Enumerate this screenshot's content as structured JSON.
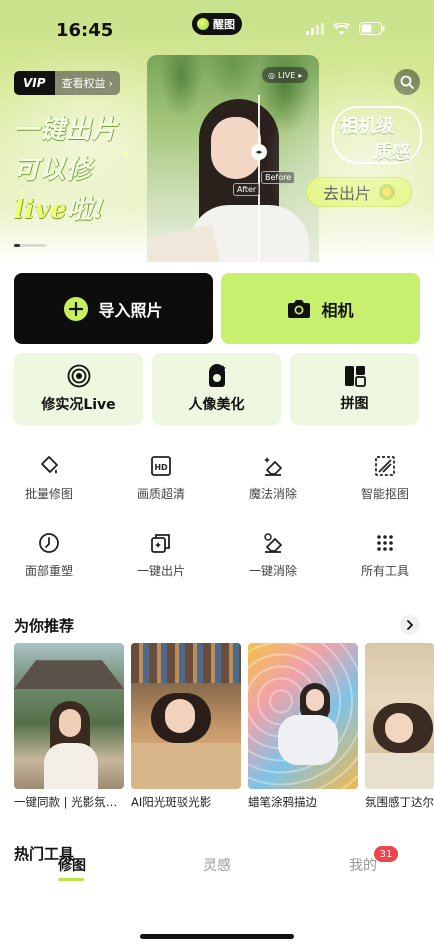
{
  "status_bar": {
    "time": "16:45",
    "island_label": "醒图"
  },
  "banner": {
    "vip_badge": "VIP",
    "vip_link": "查看权益",
    "slogan_line1": "一键出片",
    "slogan_line2_a": "可以修",
    "slogan_line2_b": "live",
    "slogan_line2_c": "啦!",
    "live_badge": "LIVE",
    "tag_after": "After",
    "tag_before": "Before",
    "camera_text_1": "相机级",
    "camera_text_2": "质感",
    "go_button": "去出片"
  },
  "actions": {
    "import": "导入照片",
    "camera": "相机"
  },
  "features": [
    {
      "label": "修实况Live",
      "icon": "live-photo-icon"
    },
    {
      "label": "人像美化",
      "icon": "portrait-icon"
    },
    {
      "label": "拼图",
      "icon": "collage-icon"
    }
  ],
  "tools": [
    {
      "label": "批量修图",
      "icon": "batch-edit-icon"
    },
    {
      "label": "画质超清",
      "icon": "hd-icon"
    },
    {
      "label": "魔法消除",
      "icon": "magic-eraser-icon"
    },
    {
      "label": "智能抠图",
      "icon": "cutout-icon"
    },
    {
      "label": "面部重塑",
      "icon": "face-reshape-icon"
    },
    {
      "label": "一键出片",
      "icon": "one-click-icon"
    },
    {
      "label": "一键消除",
      "icon": "one-click-erase-icon"
    },
    {
      "label": "所有工具",
      "icon": "all-tools-icon"
    }
  ],
  "recommend": {
    "title": "为你推荐",
    "items": [
      {
        "label": "一键同款 | 光影氛围感"
      },
      {
        "label": "AI阳光斑驳光影"
      },
      {
        "label": "蜡笔涂鸦描边"
      },
      {
        "label": "氛围感丁达尔"
      }
    ]
  },
  "hot_tools": {
    "title": "热门工具"
  },
  "tabbar": {
    "tabs": [
      {
        "label": "修图"
      },
      {
        "label": "灵感"
      },
      {
        "label": "我的"
      }
    ],
    "badge": "31"
  },
  "colors": {
    "accent": "#c8ef6d",
    "feature_bg": "#eef7df",
    "badge": "#f0434b"
  }
}
